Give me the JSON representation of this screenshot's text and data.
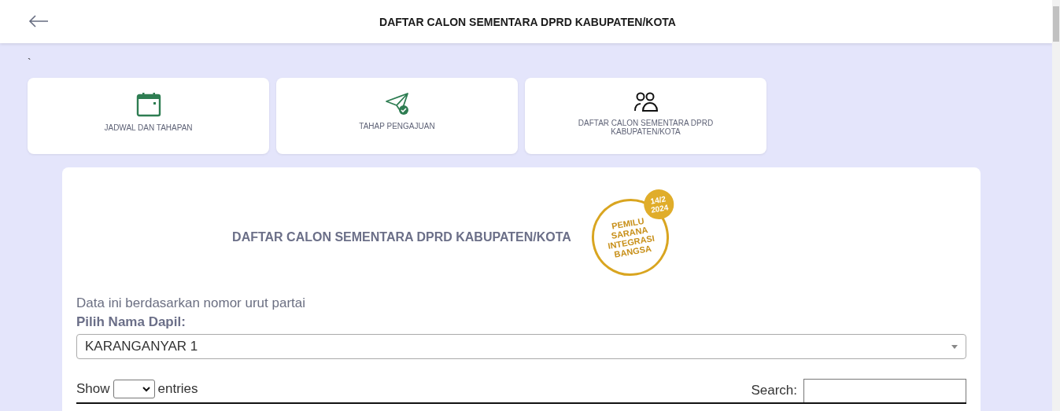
{
  "header": {
    "title": "DAFTAR CALON SEMENTARA DPRD KABUPATEN/KOTA"
  },
  "stray_mark": "`",
  "menu_cards": [
    {
      "kind": "calendar",
      "label": "JADWAL DAN TAHAPAN"
    },
    {
      "kind": "send",
      "label": "TAHAP PENGAJUAN"
    },
    {
      "kind": "people",
      "label": "DAFTAR CALON SEMENTARA DPRD KABUPATEN/KOTA"
    }
  ],
  "panel": {
    "title": "DAFTAR CALON SEMENTARA DPRD KABUPATEN/KOTA",
    "logo": {
      "lines": [
        "PEMILU",
        "SARANA",
        "INTEGRASI",
        "BANGSA"
      ],
      "date": [
        "14/2",
        "2024"
      ]
    },
    "note": "Data ini berdasarkan nomor urut partai",
    "dapil_label": "Pilih Nama Dapil:",
    "dapil_value": "KARANGANYAR 1",
    "show_label": "Show",
    "entries_label": "entries",
    "search_label": "Search:"
  }
}
